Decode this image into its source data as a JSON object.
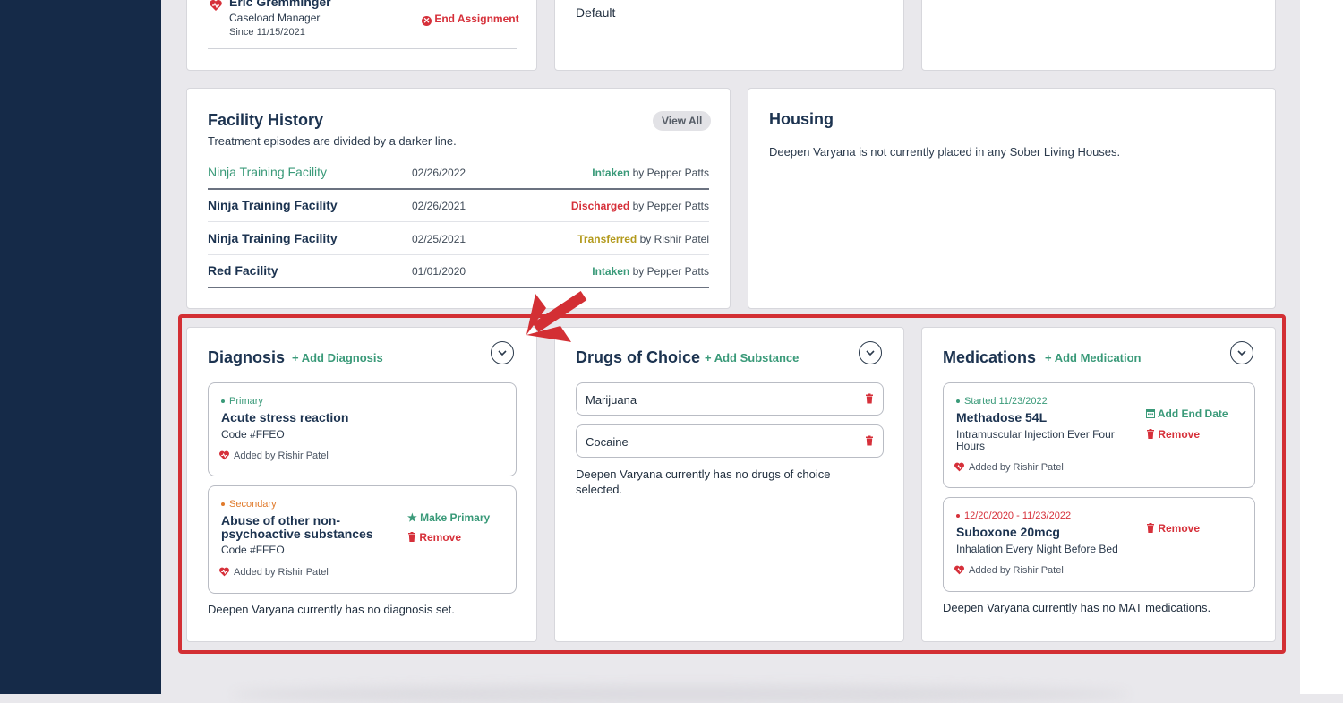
{
  "assignment": {
    "name": "Eric Gremminger",
    "role": "Caseload Manager",
    "since": "Since 11/15/2021",
    "end_label": "End Assignment"
  },
  "top_middle": {
    "value": "Default"
  },
  "facility_history": {
    "title": "Facility History",
    "view_all": "View All",
    "subtitle": "Treatment episodes are divided by a darker line.",
    "by_label": "by",
    "rows": [
      {
        "facility": "Ninja Training Facility",
        "date": "02/26/2022",
        "status": "Intaken",
        "by": "Pepper Patts"
      },
      {
        "facility": "Ninja Training Facility",
        "date": "02/26/2021",
        "status": "Discharged",
        "by": "Pepper Patts"
      },
      {
        "facility": "Ninja Training Facility",
        "date": "02/25/2021",
        "status": "Transferred",
        "by": "Rishir Patel"
      },
      {
        "facility": "Red Facility",
        "date": "01/01/2020",
        "status": "Intaken",
        "by": "Pepper Patts"
      }
    ]
  },
  "housing": {
    "title": "Housing",
    "message": "Deepen Varyana is not currently placed in any Sober Living Houses."
  },
  "diagnosis": {
    "title": "Diagnosis",
    "add_label": "+ Add Diagnosis",
    "items": [
      {
        "tag": "Primary",
        "name": "Acute stress reaction",
        "code": "Code #FFEO",
        "added_by": "Added by Rishir Patel"
      },
      {
        "tag": "Secondary",
        "name_line1": "Abuse of other non-",
        "name_line2": "psychoactive substances",
        "code": "Code #FFEO",
        "added_by": "Added by Rishir Patel",
        "make_primary": "Make Primary",
        "remove": "Remove"
      }
    ],
    "empty_message": "Deepen Varyana currently has no diagnosis set."
  },
  "drugs": {
    "title": "Drugs of Choice",
    "add_label": "+ Add Substance",
    "items": [
      "Marijuana",
      "Cocaine"
    ],
    "empty_line1": "Deepen Varyana currently has no drugs of choice",
    "empty_line2": "selected."
  },
  "medications": {
    "title": "Medications",
    "add_label": "+ Add Medication",
    "items": [
      {
        "tag": "Started 11/23/2022",
        "name": "Methadose 54L",
        "desc_line1": "Intramuscular Injection Ever Four",
        "desc_line2": "Hours",
        "added_by": "Added by Rishir Patel",
        "add_end": "Add End Date",
        "remove": "Remove"
      },
      {
        "tag": "12/20/2020 - 11/23/2022",
        "name": "Suboxone 20mcg",
        "desc_line1": "Inhalation Every Night Before Bed",
        "added_by": "Added by Rishir Patel",
        "remove": "Remove"
      }
    ],
    "empty_message": "Deepen Varyana currently has no MAT medications."
  },
  "colors": {
    "accent_green": "#3a9a79",
    "danger_red": "#d6303a",
    "navy": "#1c3350",
    "sidebar": "#152a48"
  }
}
